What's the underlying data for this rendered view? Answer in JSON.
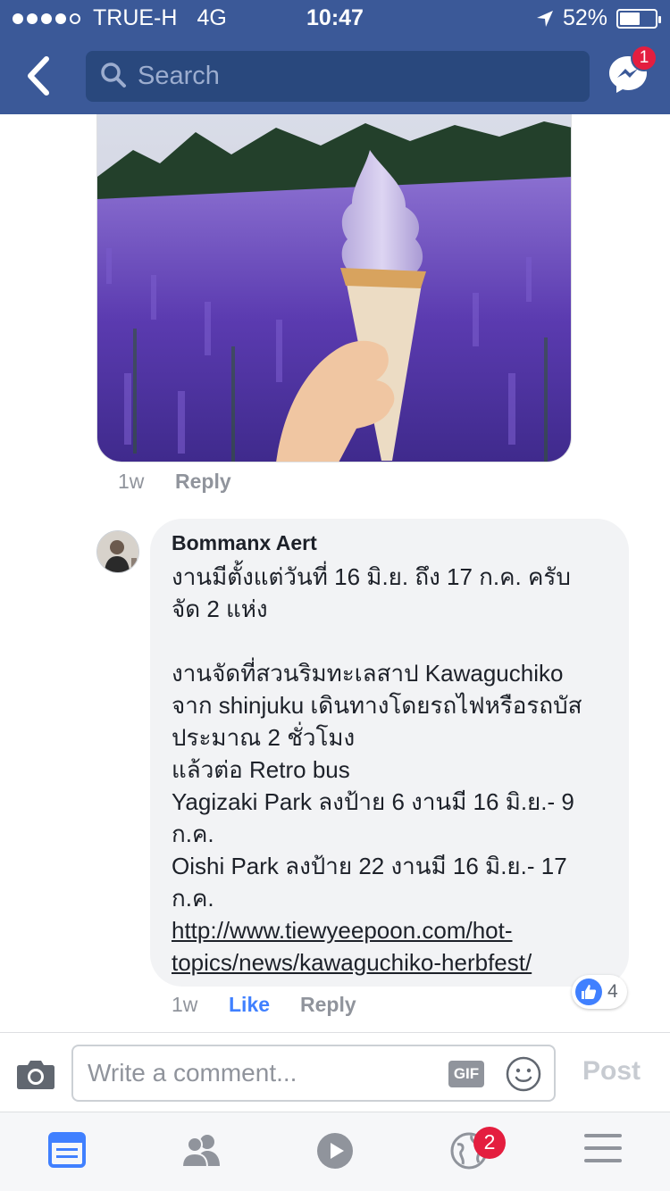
{
  "status_bar": {
    "carrier": "TRUE-H",
    "network": "4G",
    "time": "10:47",
    "battery": "52%",
    "signal_bars": 4,
    "battery_level": 0.52
  },
  "nav": {
    "search_placeholder": "Search",
    "messenger_badge": "1"
  },
  "post_photo": {
    "meta": {
      "time": "1w",
      "reply_label": "Reply"
    }
  },
  "comment": {
    "author": "Bommanx Aert",
    "lines": [
      "งานมีตั้งแต่วันที่ 16 มิ.ย. ถึง 17 ก.ค. ครับ",
      "จัด 2 แห่ง",
      "",
      "งานจัดที่สวนริมทะเลสาป Kawaguchiko",
      "จาก shinjuku เดินทางโดยรถไฟหรือรถบัส",
      "ประมาณ 2 ชั่วโมง",
      "แล้วต่อ Retro bus",
      "Yagizaki Park ลงป้าย 6 งานมี 16 มิ.ย.- 9",
      "ก.ค.",
      "Oishi Park ลงป้าย 22 งานมี 16 มิ.ย.- 17",
      "ก.ค."
    ],
    "link_lines": [
      "http://www.tiewyeepoon.com/hot-",
      "topics/news/kawaguchiko-herbfest/"
    ],
    "reaction_count": "4",
    "meta": {
      "time": "1w",
      "like_label": "Like",
      "reply_label": "Reply"
    }
  },
  "composer": {
    "placeholder": "Write a comment...",
    "gif_label": "GIF",
    "post_label": "Post"
  },
  "tabbar": {
    "notifications_badge": "2"
  },
  "colors": {
    "brand": "#3b5998",
    "link_blue": "#4080ff",
    "badge_red": "#e41e3f",
    "bubble_gray": "#f2f3f5"
  }
}
